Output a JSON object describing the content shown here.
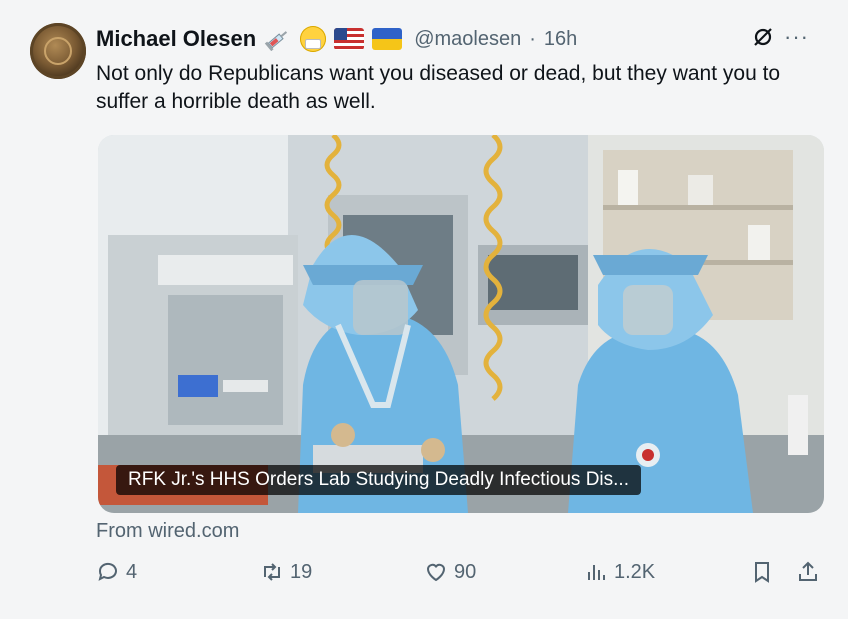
{
  "author": {
    "name": "Michael Olesen",
    "handle": "@maolesen",
    "separator": "·",
    "time": "16h",
    "emojis": [
      "syringe-icon",
      "face-with-mask-icon",
      "us-flag-icon",
      "ukraine-flag-icon"
    ]
  },
  "tweet": {
    "text": "Not only do Republicans want you diseased or dead, but they want you to suffer a horrible death as well."
  },
  "card": {
    "headline": "RFK Jr.'s HHS Orders Lab Studying Deadly Infectious Dis...",
    "source": "From wired.com"
  },
  "actions": {
    "replies": "4",
    "reposts": "19",
    "likes": "90",
    "views": "1.2K"
  },
  "colors": {
    "text": "#0f1419",
    "secondary": "#536471",
    "background": "#f4f5f6",
    "suit": "#6fb6e3"
  }
}
